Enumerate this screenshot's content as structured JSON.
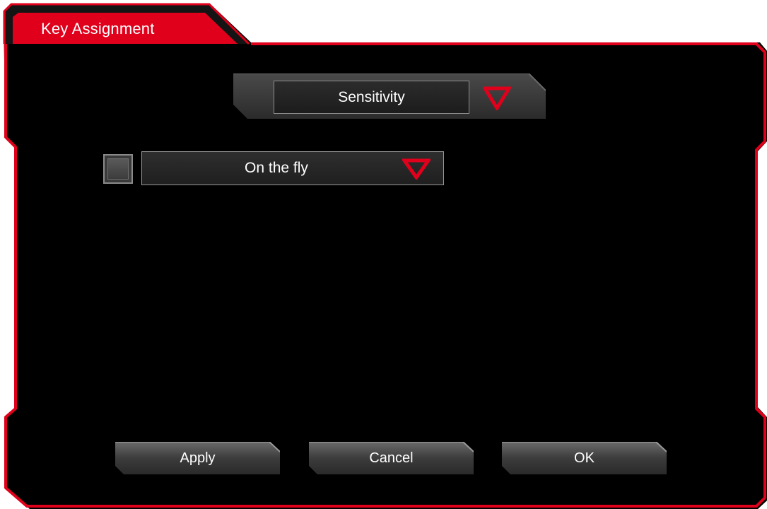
{
  "window": {
    "title": "Key Assignment"
  },
  "function_select": {
    "value": "Sensitivity"
  },
  "mode_select": {
    "checked": false,
    "value": "On the fly"
  },
  "buttons": {
    "apply": "Apply",
    "cancel": "Cancel",
    "ok": "OK"
  },
  "colors": {
    "accent": "#e0001b",
    "background": "#000000",
    "panel": "#2a2a2a"
  }
}
